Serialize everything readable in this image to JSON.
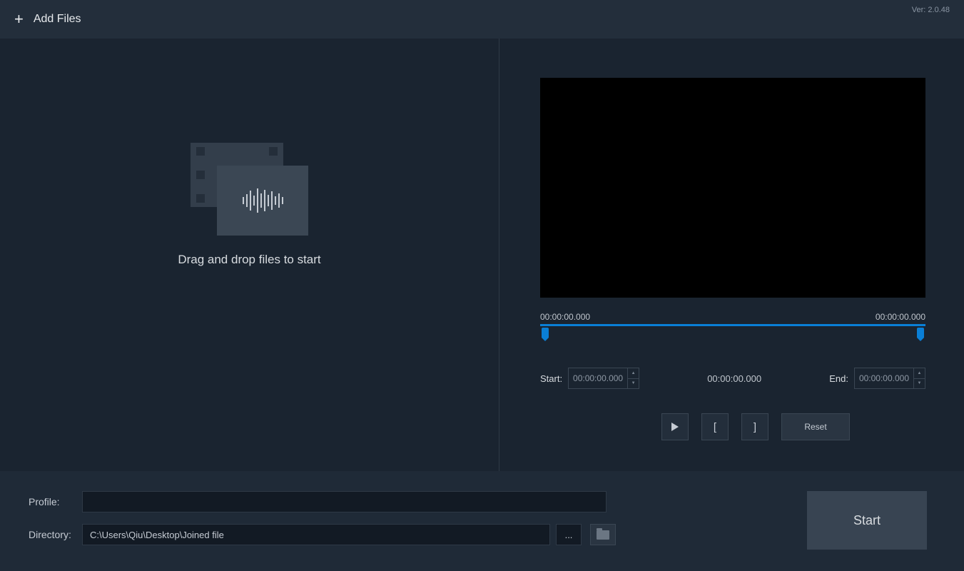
{
  "header": {
    "add_files": "Add Files",
    "version": "Ver: 2.0.48"
  },
  "left": {
    "drop_text": "Drag and drop files to start"
  },
  "timeline": {
    "start_label": "00:00:00.000",
    "end_label": "00:00:00.000"
  },
  "times": {
    "start_label": "Start:",
    "start_value": "00:00:00.000",
    "current": "00:00:00.000",
    "end_label": "End:",
    "end_value": "00:00:00.000"
  },
  "controls": {
    "bracket_open": "[",
    "bracket_close": "]",
    "reset": "Reset"
  },
  "bottom": {
    "profile_label": "Profile:",
    "profile_value": "",
    "directory_label": "Directory:",
    "directory_value": "C:\\Users\\Qiu\\Desktop\\Joined file",
    "dots": "...",
    "start": "Start"
  }
}
